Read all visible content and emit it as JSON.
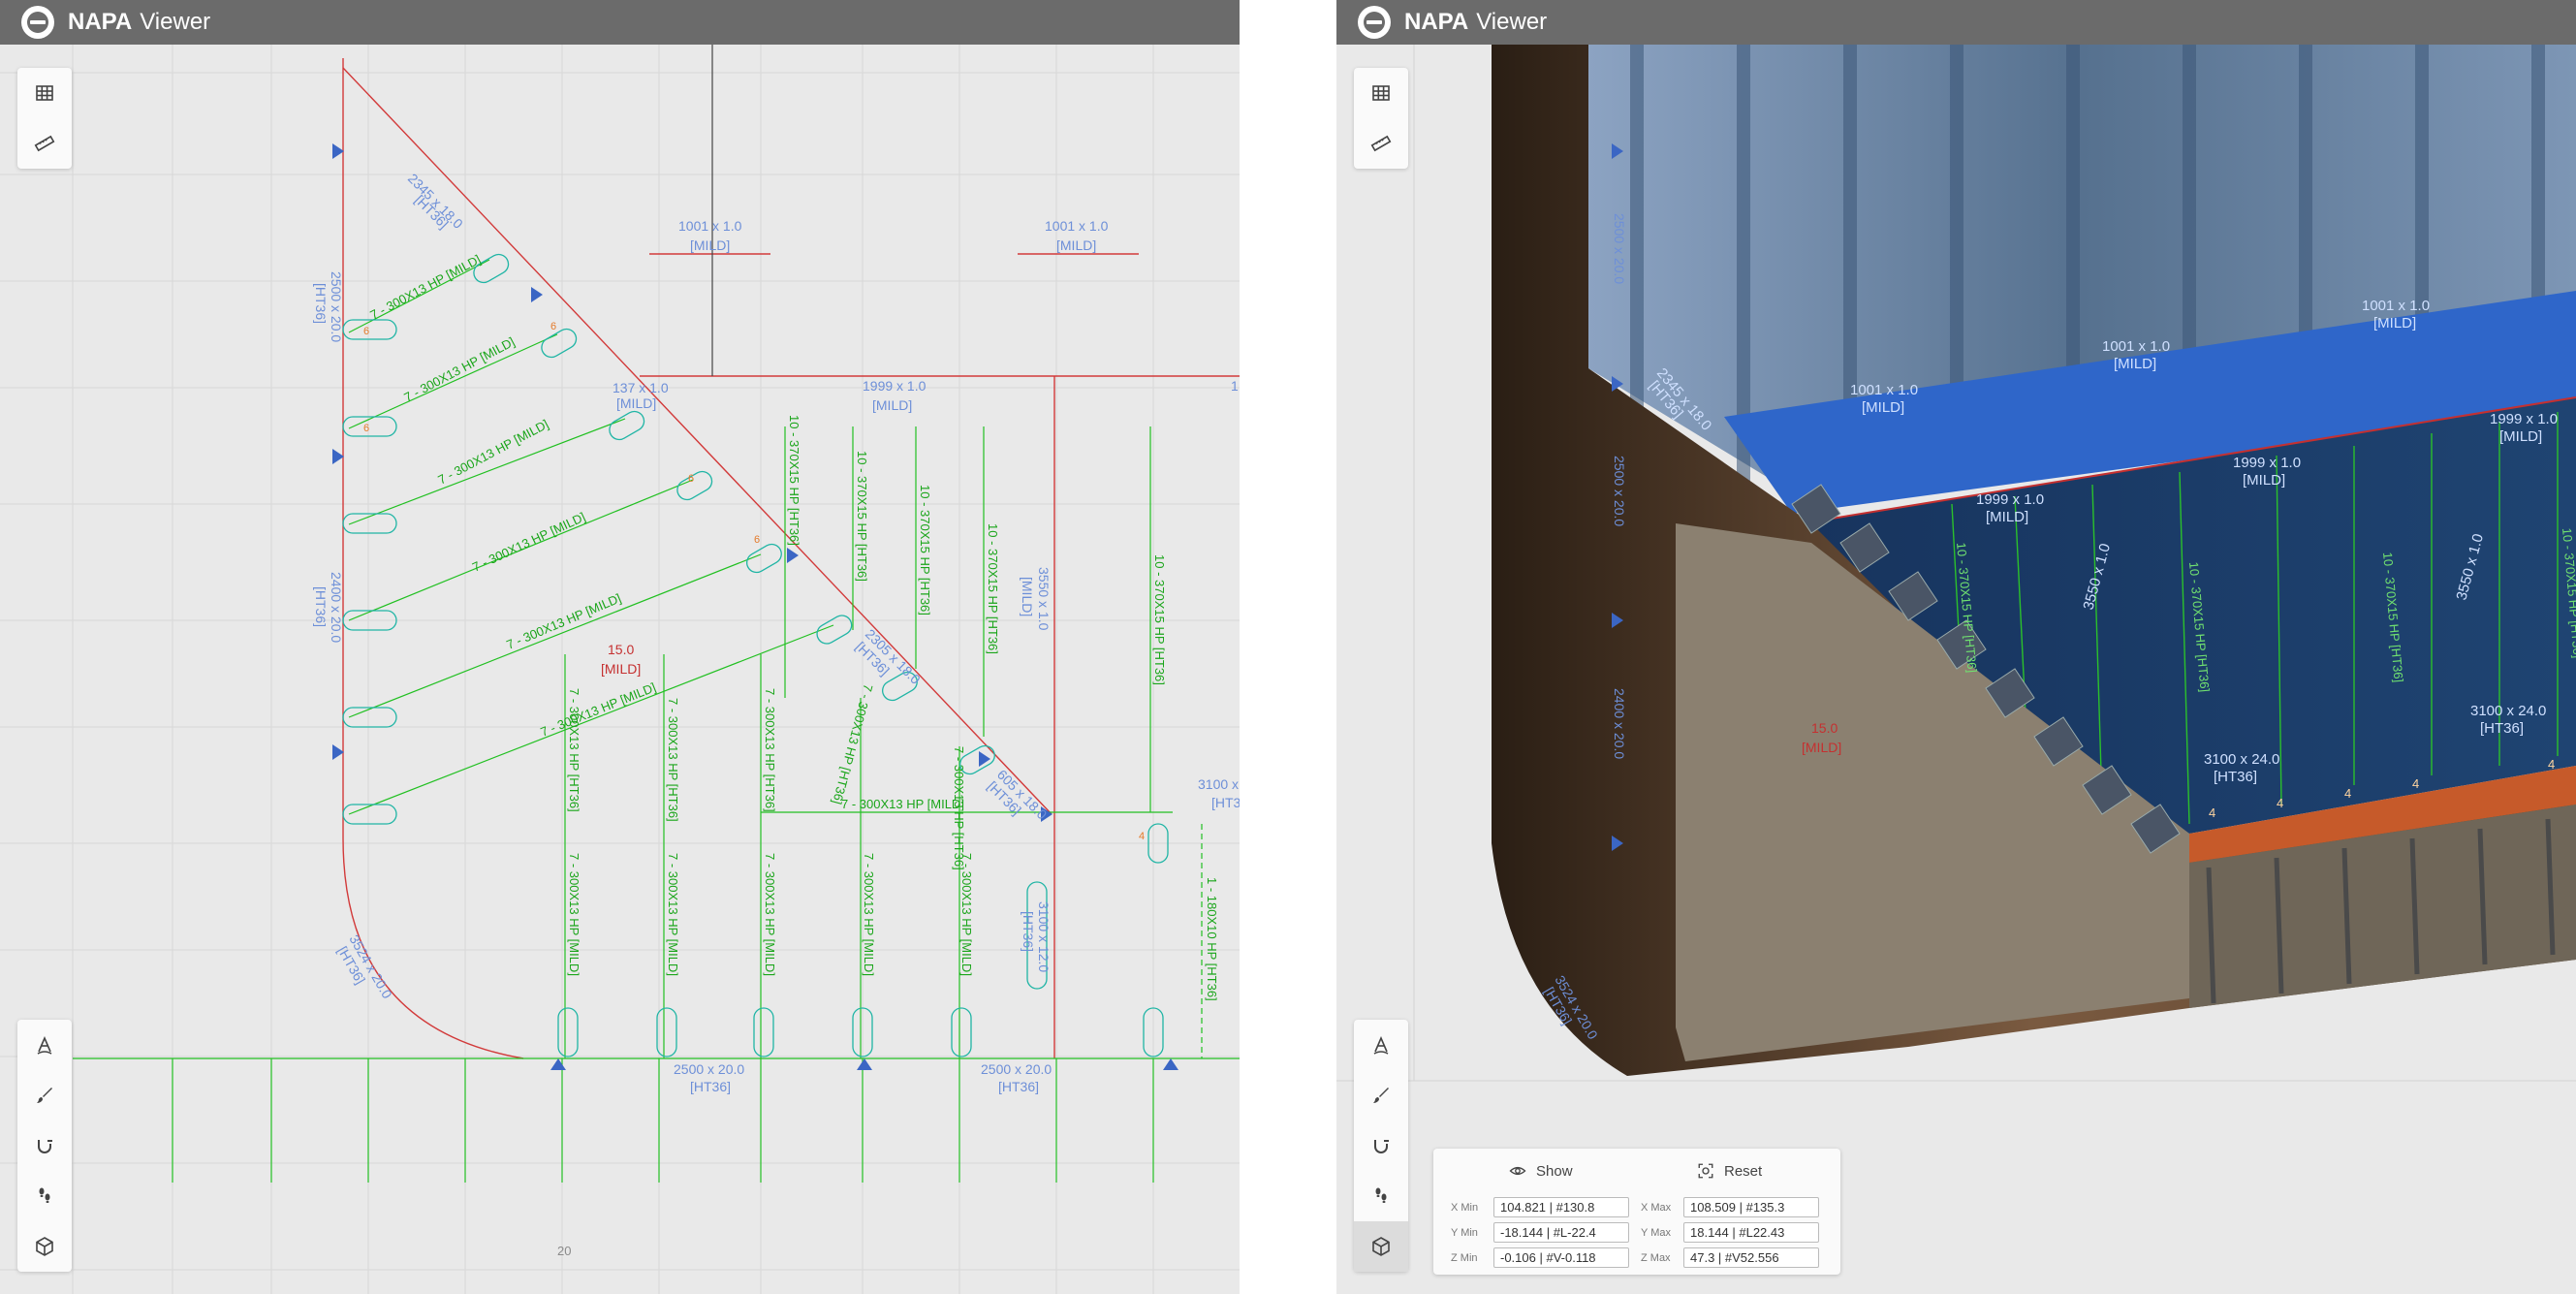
{
  "app": {
    "brand": "NAPA",
    "name": "Viewer"
  },
  "colors": {
    "titlebar": "#6b6b6b",
    "plate_line": "#d23a3a",
    "stiffener": "#22c022",
    "label": "#6d8fd8",
    "hull_brown": "#7a5a40",
    "deck_blue": "#1c3c6a"
  },
  "toolbar_top": [
    {
      "icon": "grid-icon"
    },
    {
      "icon": "ruler-icon"
    }
  ],
  "toolbar_bottom": [
    {
      "icon": "text-tool-icon"
    },
    {
      "icon": "brush-icon"
    },
    {
      "icon": "magnet-icon"
    },
    {
      "icon": "footsteps-icon"
    },
    {
      "icon": "cube-icon"
    }
  ],
  "left_view": {
    "plate_labels": [
      {
        "size": "2345 x 18.0",
        "grade": "[HT36]"
      },
      {
        "size": "2500 x 20.0",
        "grade": "[HT36]"
      },
      {
        "size": "2400 x 20.0",
        "grade": "[HT36]"
      },
      {
        "size": "1001 x 1.0",
        "grade": "[MILD]"
      },
      {
        "size": "1001 x 1.0",
        "grade": "[MILD]"
      },
      {
        "size": "1999 x 1.0",
        "grade": "[MILD]"
      },
      {
        "size": "137 x 1.0",
        "grade": "[MILD]"
      },
      {
        "size": "2305 x 18.0",
        "grade": "[HT36]"
      },
      {
        "size": "3550 x 1.0",
        "grade": "[MILD]"
      },
      {
        "size": "3524 x 20.0",
        "grade": "[HT36]"
      },
      {
        "size": "2500 x 20.0",
        "grade": "[HT36]"
      },
      {
        "size": "2500 x 20.0",
        "grade": "[HT36]"
      },
      {
        "size": "3100 x",
        "grade": "[HT3"
      },
      {
        "size": "3100 x 12.0",
        "grade": "[HT36]"
      },
      {
        "size": "605 x 18.0",
        "grade": "[HT36]"
      },
      {
        "size": "1",
        "grade": ""
      }
    ],
    "diag_stiffeners": [
      "7 - 300X13 HP [MILD]",
      "7 - 300X13 HP [MILD]",
      "7 - 300X13 HP [MILD]",
      "7 - 300X13 HP [MILD]",
      "7 - 300X13 HP [MILD]",
      "7 - 300X13 HP [MILD]"
    ],
    "vert_stiffeners_upper": [
      "10 - 370X15 HP [HT36]",
      "10 - 370X15 HP [HT36]",
      "10 - 370X15 HP [HT36]",
      "10 - 370X15 HP [HT36]",
      "10 - 370X15 HP [HT36]"
    ],
    "vert_stiffeners_mid": [
      "7 - 300X13 HP [HT36]",
      "7 - 300X13 HP [HT36]",
      "7 - 300X13 HP [HT36]",
      "7 - 300X13 HP [HT36]",
      "7 - 300X13 HP [HT36]"
    ],
    "vert_stiffeners_lower": [
      "7 - 300X13 HP [MILD]",
      "7 - 300X13 HP [MILD]",
      "7 - 300X13 HP [MILD]",
      "7 - 300X13 HP [MILD]",
      "7 - 300X13 HP [MILD]"
    ],
    "horiz_stiffener": "7 - 300X13 HP [MILD]",
    "right_stiffener": "1 - 180X10 HP [HT36]",
    "thickness": {
      "value": "15.0",
      "grade": "[MILD]"
    },
    "frame_number": "20",
    "orange_marks": [
      "6",
      "6",
      "6",
      "6",
      "6",
      "4"
    ]
  },
  "right_view": {
    "plate_labels": [
      {
        "size": "1001 x 1.0",
        "grade": "[MILD]"
      },
      {
        "size": "1001 x 1.0",
        "grade": "[MILD]"
      },
      {
        "size": "1001 x 1.0",
        "grade": "[MILD]"
      },
      {
        "size": "1999 x 1.0",
        "grade": "[MILD]"
      },
      {
        "size": "1999 x 1.0",
        "grade": "[MILD]"
      },
      {
        "size": "1999 x 1.0",
        "grade": "[MILD]"
      },
      {
        "size": "3550 x 1.0",
        "grade": ""
      },
      {
        "size": "3550 x 1.0",
        "grade": ""
      },
      {
        "size": "3100 x 24.0",
        "grade": "[HT36]"
      },
      {
        "size": "3100 x 24.0",
        "grade": "[HT36]"
      },
      {
        "size": "2345 x 18.0",
        "grade": "[HT36]"
      },
      {
        "size": "2500 x 20.0",
        "grade": ""
      },
      {
        "size": "2500 x 20.0",
        "grade": ""
      },
      {
        "size": "2400 x 20.0",
        "grade": ""
      },
      {
        "size": "3524 x 20.0",
        "grade": "[HT36]"
      }
    ],
    "vert_stiffener": "10 - 370X15 HP [HT36]",
    "thickness": {
      "value": "15.0",
      "grade": "[MILD]"
    },
    "bottom_marks": [
      "4",
      "4",
      "4",
      "4",
      "4"
    ]
  },
  "clip_panel": {
    "show_label": "Show",
    "reset_label": "Reset",
    "x_min_label": "X Min",
    "x_min": "104.821 | #130.8",
    "x_max_label": "X Max",
    "x_max": "108.509 | #135.3",
    "y_min_label": "Y Min",
    "y_min": "-18.144 | #L-22.4",
    "y_max_label": "Y Max",
    "y_max": "18.144 | #L22.43",
    "z_min_label": "Z Min",
    "z_min": "-0.106 | #V-0.118",
    "z_max_label": "Z Max",
    "z_max": "47.3 | #V52.556"
  }
}
